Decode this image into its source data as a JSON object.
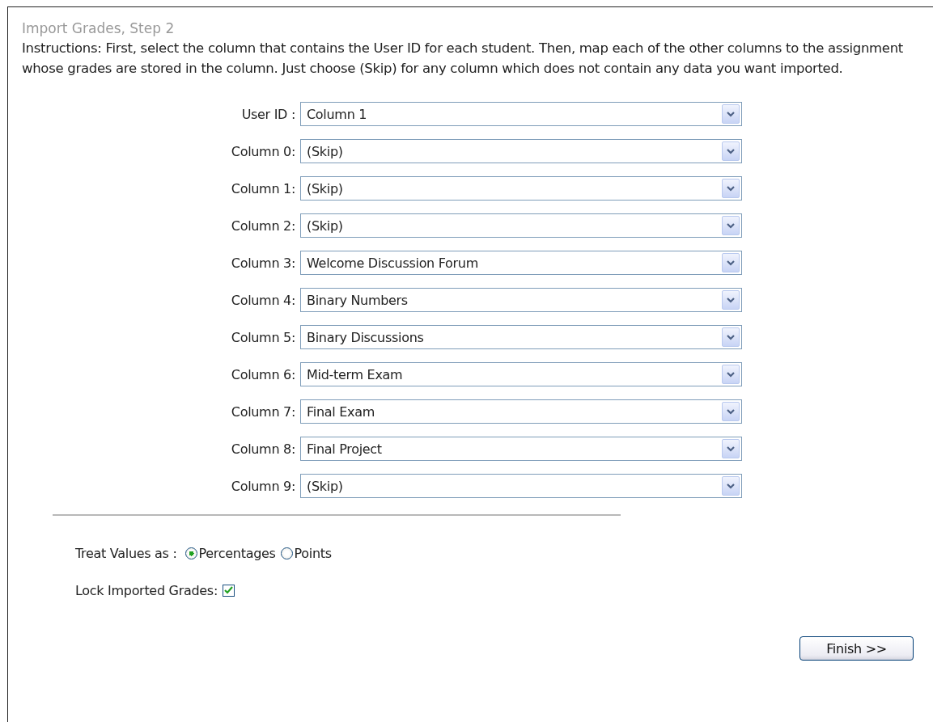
{
  "title": "Import Grades, Step 2",
  "instructions": "Instructions: First, select the column that contains the User ID for each student. Then, map each of the other columns to the assignment whose grades are stored in the column. Just choose (Skip) for any column which does not contain any data you want imported.",
  "mappings": [
    {
      "label": "User ID :",
      "value": "Column 1"
    },
    {
      "label": "Column 0:",
      "value": "(Skip)"
    },
    {
      "label": "Column 1:",
      "value": "(Skip)"
    },
    {
      "label": "Column 2:",
      "value": "(Skip)"
    },
    {
      "label": "Column 3:",
      "value": "Welcome Discussion Forum"
    },
    {
      "label": "Column 4:",
      "value": "Binary Numbers"
    },
    {
      "label": "Column 5:",
      "value": "Binary Discussions"
    },
    {
      "label": "Column 6:",
      "value": "Mid-term Exam"
    },
    {
      "label": "Column 7:",
      "value": "Final Exam"
    },
    {
      "label": "Column 8:",
      "value": "Final Project"
    },
    {
      "label": "Column 9:",
      "value": "(Skip)"
    }
  ],
  "treat_values": {
    "label": "Treat Values as :",
    "options": [
      {
        "label": "Percentages",
        "selected": true
      },
      {
        "label": "Points",
        "selected": false
      }
    ]
  },
  "lock_grades": {
    "label": "Lock Imported Grades:",
    "checked": true
  },
  "finish_button": "Finish >>"
}
